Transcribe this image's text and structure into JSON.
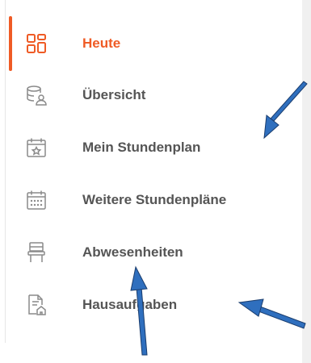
{
  "colors": {
    "accent": "#ef5b25",
    "label": "#555555",
    "icon": "#8a8a8a",
    "arrow": "#2f6fbe",
    "arrow_outline": "#1a3d6e"
  },
  "menu": {
    "items": [
      {
        "label": "Heute",
        "icon": "dashboard-grid-icon",
        "active": true
      },
      {
        "label": "Übersicht",
        "icon": "database-person-icon",
        "active": false
      },
      {
        "label": "Mein Stundenplan",
        "icon": "calendar-star-icon",
        "active": false
      },
      {
        "label": "Weitere Stundenpläne",
        "icon": "calendar-dots-icon",
        "active": false
      },
      {
        "label": "Abwesenheiten",
        "icon": "chair-icon",
        "active": false
      },
      {
        "label": "Hausaufgaben",
        "icon": "document-home-icon",
        "active": false
      }
    ]
  }
}
